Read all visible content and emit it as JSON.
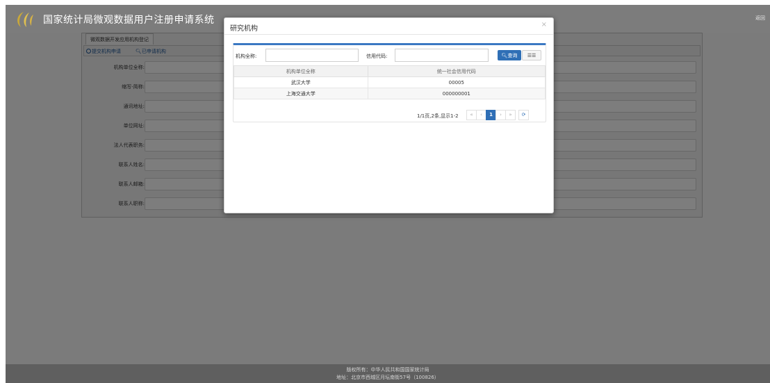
{
  "header": {
    "title": "国家统计局微观数据用户注册申请系统",
    "back": "返回"
  },
  "tabs": [
    "微观数据开发应用机构登记"
  ],
  "subnav": {
    "submit": "提交机构申请",
    "applied": "已申请机构"
  },
  "form": {
    "fields": [
      {
        "label": "机构单位全称:"
      },
      {
        "label": "缩写-简称:"
      },
      {
        "label": "通讯地址:"
      },
      {
        "label": "单位网址:"
      },
      {
        "label": "法人代表职务:"
      },
      {
        "label": "联系人姓名:"
      },
      {
        "label": "联系人邮箱:"
      },
      {
        "label": "联系人职称:"
      }
    ]
  },
  "modal": {
    "title": "研究机构",
    "close": "×",
    "search": {
      "name_label": "机构全称:",
      "name_value": "",
      "code_label": "信用代码:",
      "code_value": "",
      "search_button": "查询",
      "columns_button": "☰☰"
    },
    "table": {
      "headers": [
        "机构单位全称",
        "统一社会信用代码"
      ],
      "rows": [
        [
          "武汉大学",
          "00005"
        ],
        [
          "上海交通大学",
          "000000001"
        ]
      ]
    },
    "pagination": {
      "info": "1/1页,2条,显示1-2",
      "first": "«",
      "prev": "‹",
      "current": "1",
      "next": "›",
      "last": "»",
      "refresh": "⟳"
    }
  },
  "footer": {
    "line1": "版权所有：中华人民共和国国家统计局",
    "line2": "地址：北京市西城区月坛南街57号（100826）"
  },
  "colors": {
    "header_bg": "#7c7c7c",
    "accent": "#2f6fb6",
    "overlay": "#7b7b7b"
  }
}
